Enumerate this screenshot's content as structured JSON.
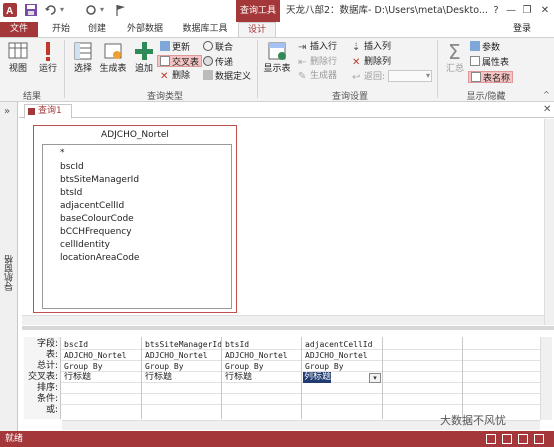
{
  "title_bar": {
    "window_title": "天龙八部2：数据库- D:\\Users\\meta\\Deskto...",
    "context_tab_group": "查询工具",
    "help": "?",
    "minimize": "—",
    "restore": "❐",
    "close": "✕"
  },
  "tabs": {
    "file": "文件",
    "home": "开始",
    "create": "创建",
    "external": "外部数据",
    "dbtools": "数据库工具",
    "design": "设计"
  },
  "login": "登录",
  "ribbon": {
    "view": "视图",
    "run": "运行",
    "select": "选择",
    "make_table": "生成表",
    "append": "追加",
    "update": "更新",
    "crosstab": "交叉表",
    "delete": "删除",
    "union": "联合",
    "pass_through": "传递",
    "data_definition": "数据定义",
    "show_table": "显示表",
    "insert_row": "插入行",
    "delete_row": "删除行",
    "builder": "生成器",
    "insert_col": "插入列",
    "delete_col": "删除列",
    "return": "返回:",
    "totals": "汇总",
    "params": "参数",
    "property_sheet": "属性表",
    "table_names": "表名称",
    "groups": {
      "results": "结果",
      "query_type": "查询类型",
      "query_setup": "查询设置",
      "show_hide": "显示/隐藏"
    }
  },
  "nav_pane_label": "导航窗格",
  "doc_tab": "查询1",
  "table_box": {
    "title": "ADJCHO_Nortel",
    "fields": [
      "*",
      "bscId",
      "btsSiteManagerId",
      "btsId",
      "adjacentCellId",
      "baseColourCode",
      "bCCHFrequency",
      "cellIdentity",
      "locationAreaCode"
    ]
  },
  "grid": {
    "row_labels": [
      "字段:",
      "表:",
      "总计:",
      "交叉表:",
      "排序:",
      "条件:",
      "或:"
    ],
    "columns": [
      {
        "field": "bscId",
        "table": "ADJCHO_Nortel",
        "total": "Group By",
        "crosstab": "行标题"
      },
      {
        "field": "btsSiteManagerId",
        "table": "ADJCHO_Nortel",
        "total": "Group By",
        "crosstab": "行标题"
      },
      {
        "field": "btsId",
        "table": "ADJCHO_Nortel",
        "total": "Group By",
        "crosstab": "行标题"
      },
      {
        "field": "adjacentCellId",
        "table": "ADJCHO_Nortel",
        "total": "Group By",
        "crosstab": "列标题"
      }
    ]
  },
  "status": "就绪",
  "watermark": "大数据不风忧"
}
